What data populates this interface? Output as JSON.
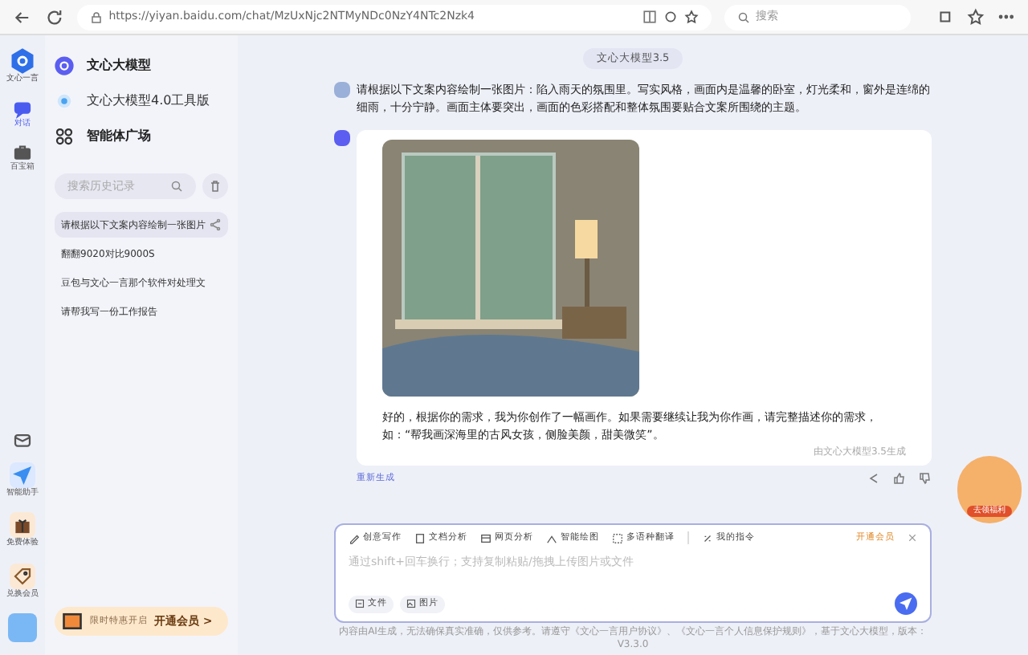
{
  "browser": {
    "url": "https://yiyan.baidu.com/chat/MzUxNjc2NTMyNDc0NzY4NTc2Nzk4",
    "search_placeholder": "搜索"
  },
  "rail": {
    "logo_label": "文心一言",
    "items": [
      {
        "label": "对话",
        "selected": true
      },
      {
        "label": "百宝箱",
        "selected": false
      }
    ],
    "bottom_items": [
      {
        "label": "智能助手"
      },
      {
        "label": "免费体验"
      },
      {
        "label": "兑换会员"
      }
    ]
  },
  "sidebar": {
    "menu": [
      {
        "label": "文心大模型",
        "kind": "model"
      },
      {
        "label": "文心大模型4.0工具版",
        "kind": "tool"
      },
      {
        "label": "智能体广场",
        "kind": "grid"
      }
    ],
    "search_placeholder": "搜索历史记录",
    "history": [
      {
        "title": "请根据以下文案内容绘制一张图片",
        "selected": true
      },
      {
        "title": "翻翻9020对比9000S",
        "selected": false
      },
      {
        "title": "豆包与文心一言那个软件对处理文",
        "selected": false
      },
      {
        "title": "请帮我写一份工作报告",
        "selected": false
      }
    ],
    "promo": {
      "text": "限时特惠开启",
      "action": "开通会员 >"
    }
  },
  "chat": {
    "model_tag": "文心大模型3.5",
    "user_message": "请根据以下文案内容绘制一张图片：陷入雨天的氛围里。写实风格，画面内是温馨的卧室，灯光柔和，窗外是连绵的细雨，十分宁静。画面主体要突出，画面的色彩搭配和整体氛围要贴合文案所围绕的主题。",
    "reply": {
      "text": "好的，根据你的需求，我为你创作了一幅画作。如果需要继续让我为你作画，请完整描述你的需求，如：“帮我画深海里的古风女孩，侧脸美颜，甜美微笑”。",
      "footnote": "由文心大模型3.5生成",
      "regenerate": "重新生成"
    }
  },
  "composer": {
    "tools": [
      "创意写作",
      "文档分析",
      "网页分析",
      "智能绘图",
      "多语种翻译",
      "我的指令"
    ],
    "vip": "开通会员",
    "placeholder": "通过shift+回车换行；支持复制粘贴/拖拽上传图片或文件",
    "attachments": [
      "文件",
      "图片"
    ]
  },
  "footer": "内容由AI生成，无法确保真实准确，仅供参考。请遵守《文心一言用户协议》、《文心一言个人信息保护规则》，基于文心大模型，版本：V3.3.0",
  "float_badge": "去领福利"
}
